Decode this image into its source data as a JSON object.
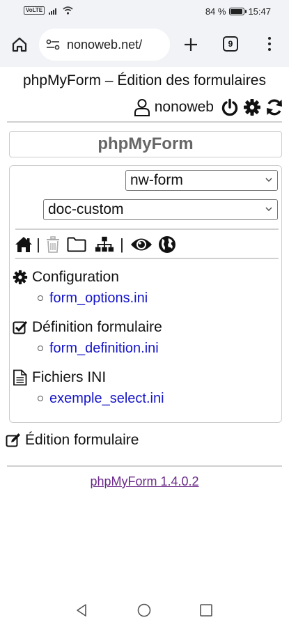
{
  "status_bar": {
    "network_badge": "VoLTE",
    "battery_text": "84 %",
    "battery_level": 0.84,
    "time": "15:47"
  },
  "browser": {
    "url": "nonoweb.net/",
    "tab_count": "9"
  },
  "page": {
    "title": "phpMyForm – Édition des formulaires",
    "username": "nonoweb",
    "app_name": "phpMyForm",
    "select_project": "nw-form",
    "select_form": "doc-custom",
    "sections": [
      {
        "icon": "gear-icon",
        "title": "Configuration",
        "items": [
          "form_options.ini"
        ]
      },
      {
        "icon": "checkbox-icon",
        "title": "Définition formulaire",
        "items": [
          "form_definition.ini"
        ]
      },
      {
        "icon": "file-text-icon",
        "title": "Fichiers INI",
        "items": [
          "exemple_select.ini"
        ]
      }
    ],
    "edit_label": "Édition formulaire",
    "footer_link": "phpMyForm 1.4.0.2"
  },
  "colors": {
    "link": "#1515c8",
    "footer_link": "#6b2a8a",
    "browser_chrome": "#f2f3f7"
  }
}
